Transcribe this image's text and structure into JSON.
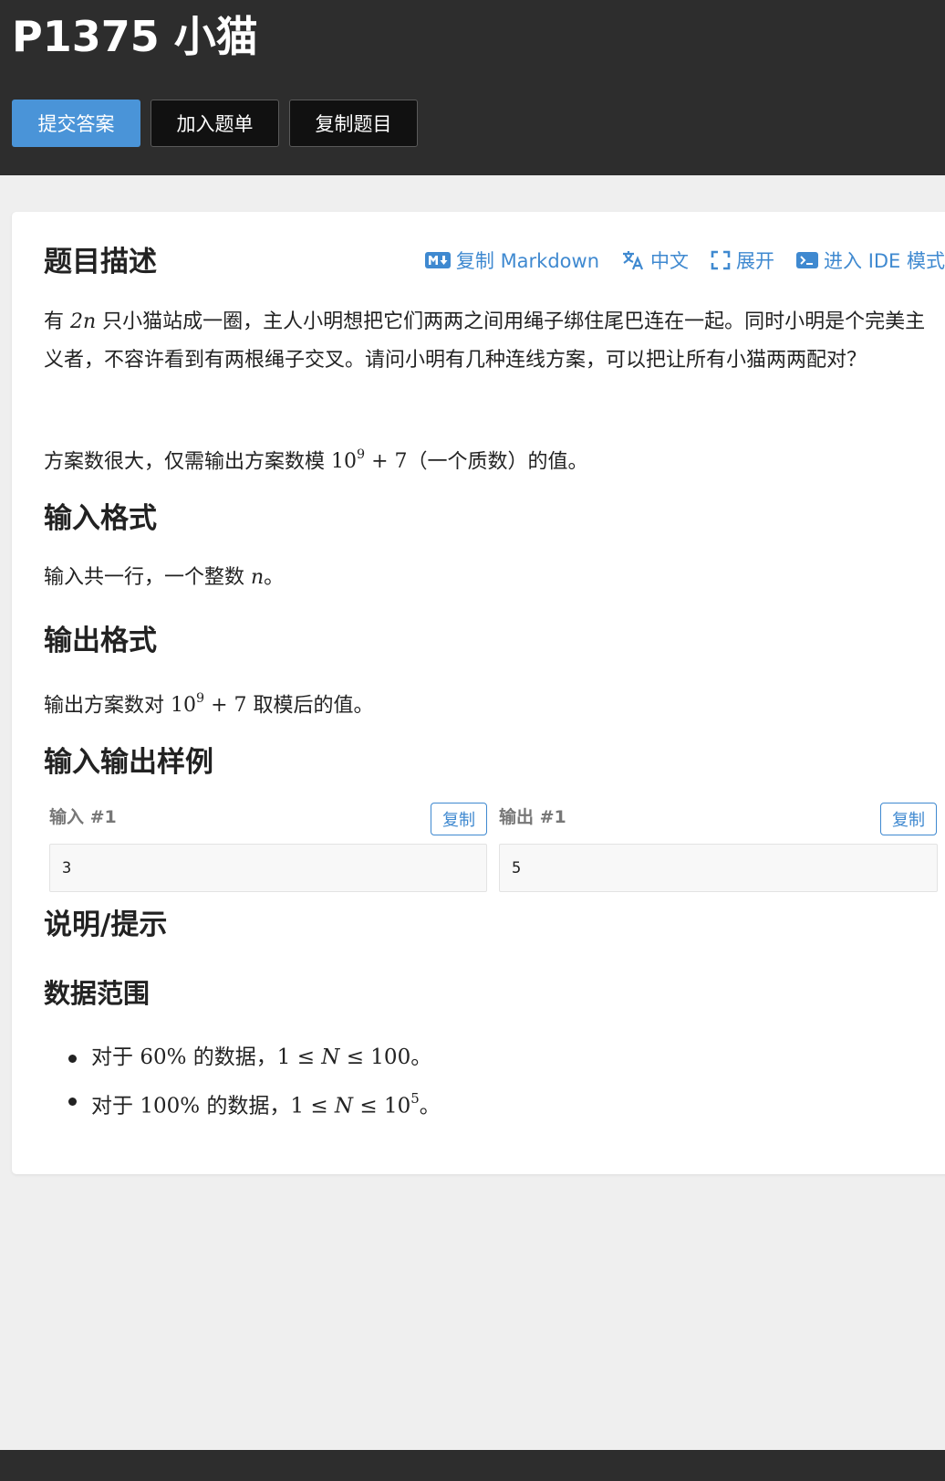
{
  "header": {
    "title": "P1375 小猫",
    "buttons": {
      "submit": "提交答案",
      "add_to_list": "加入题单",
      "copy_problem": "复制题目"
    }
  },
  "toolbar": {
    "copy_markdown": "复制 Markdown",
    "language": "中文",
    "expand": "展开",
    "ide_mode": "进入 IDE 模式"
  },
  "problem": {
    "description_heading": "题目描述",
    "description_p1": {
      "before": "有 ",
      "math": "2n",
      "after": " 只小猫站成一圈，主人小明想把它们两两之间用绳子绑住尾巴连在一起。同时小明是个完美主义者，不容许看到有两根绳子交叉。请问小明有几种连线方案，可以把让所有小猫两两配对？"
    },
    "description_p2": {
      "before": "方案数很大，仅需输出方案数模 ",
      "math_base": "10",
      "math_exp": "9",
      "math_rest": " + 7",
      "after": "（一个质数）的值。"
    },
    "input_heading": "输入格式",
    "input_text": {
      "before": "输入共一行，一个整数 ",
      "math": "n",
      "after": "。"
    },
    "output_heading": "输出格式",
    "output_text": {
      "before": "输出方案数对 ",
      "math_base": "10",
      "math_exp": "9",
      "math_rest": " + 7",
      "after": " 取模后的值。"
    },
    "samples_heading": "输入输出样例",
    "samples": [
      {
        "input_label": "输入 #1",
        "output_label": "输出 #1",
        "copy_label": "复制",
        "input": "3",
        "output": "5"
      }
    ],
    "hint_heading": "说明/提示",
    "range_heading": "数据范围",
    "ranges": [
      {
        "before": "对于 ",
        "pct": "60%",
        "mid": " 的数据，",
        "cond": "1 ≤ N ≤ 100",
        "exp": "",
        "after": "。"
      },
      {
        "before": "对于 ",
        "pct": "100%",
        "mid": " 的数据，",
        "cond": "1 ≤ N ≤ 10",
        "exp": "5",
        "after": "。"
      }
    ]
  },
  "colors": {
    "header_bg": "#2d2d2d",
    "accent": "#4a94d8",
    "link": "#3f89d0",
    "page_bg": "#efefef"
  },
  "icons": {
    "copy_markdown": "markdown-icon",
    "language": "translate-icon",
    "expand": "expand-icon",
    "ide_mode": "terminal-icon"
  }
}
